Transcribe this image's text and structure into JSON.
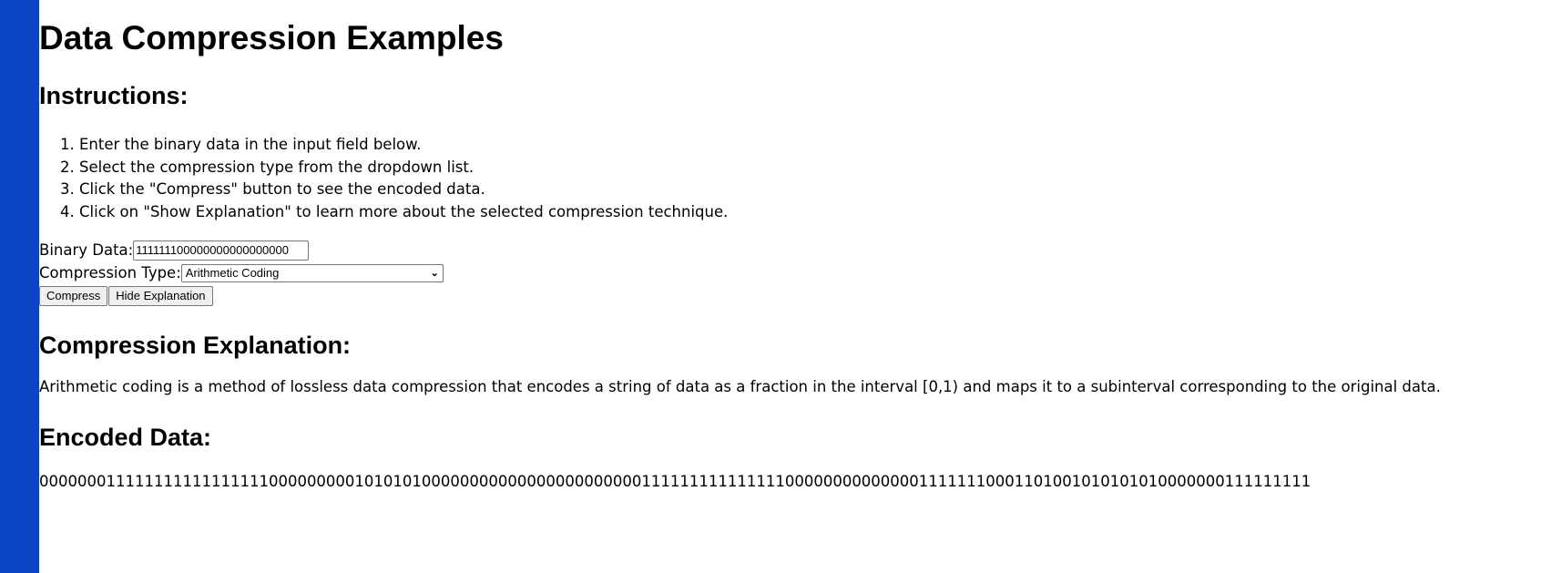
{
  "page": {
    "title": "Data Compression Examples",
    "instructions_heading": "Instructions:",
    "instructions": [
      "Enter the binary data in the input field below.",
      "Select the compression type from the dropdown list.",
      "Click the \"Compress\" button to see the encoded data.",
      "Click on \"Show Explanation\" to learn more about the selected compression technique."
    ]
  },
  "form": {
    "binary_label": "Binary Data:",
    "binary_value": "111111100000000000000000",
    "type_label": "Compression Type:",
    "type_selected": "Arithmetic Coding",
    "compress_label": "Compress",
    "explanation_toggle_label": "Hide Explanation"
  },
  "explanation": {
    "heading": "Compression Explanation:",
    "text": "Arithmetic coding is a method of lossless data compression that encodes a string of data as a fraction in the interval [0,1) and maps it to a subinterval corresponding to the original data."
  },
  "encoded": {
    "heading": "Encoded Data:",
    "value": "0000000111111111111111110000000001010101000000000000000000000001111111111111110000000000000011111110001101001010101010000000111111111"
  },
  "colors": {
    "left_bar": "#0a45c7"
  }
}
